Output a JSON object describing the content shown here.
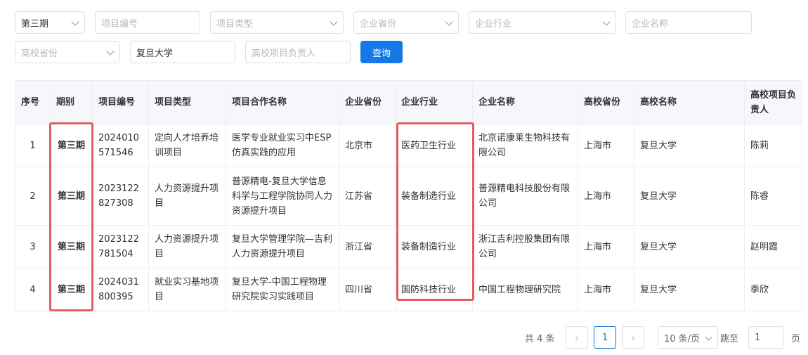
{
  "filters": {
    "period": {
      "value": "第三期"
    },
    "project_no": {
      "placeholder": "项目编号"
    },
    "project_type": {
      "placeholder": "项目类型"
    },
    "company_province": {
      "placeholder": "企业省份"
    },
    "company_industry": {
      "placeholder": "企业行业"
    },
    "company_name": {
      "placeholder": "企业名称"
    },
    "school_province": {
      "placeholder": "高校省份"
    },
    "school_name": {
      "value": "复旦大学"
    },
    "school_leader": {
      "placeholder": "高校项目负责人"
    },
    "search_label": "查询"
  },
  "table": {
    "headers": {
      "index": "序号",
      "period": "期别",
      "project_no": "项目编号",
      "project_type": "项目类型",
      "coop_name": "项目合作名称",
      "company_province": "企业省份",
      "company_industry": "企业行业",
      "company_name": "企业名称",
      "school_province": "高校省份",
      "school_name": "高校名称",
      "school_leader": "高校项目负责人"
    },
    "rows": [
      {
        "index": "1",
        "period": "第三期",
        "project_no": "2024010571546",
        "project_type": "定向人才培养培训项目",
        "coop_name": "医学专业就业实习中ESP仿真实践的应用",
        "company_province": "北京市",
        "company_industry": "医药卫生行业",
        "company_name": "北京诺康莱生物科技有限公司",
        "school_province": "上海市",
        "school_name": "复旦大学",
        "school_leader": "陈莉"
      },
      {
        "index": "2",
        "period": "第三期",
        "project_no": "2023122827308",
        "project_type": "人力资源提升项目",
        "coop_name": "普源精电-复旦大学信息科学与工程学院协同人力资源提升项目",
        "company_province": "江苏省",
        "company_industry": "装备制造行业",
        "company_name": "普源精电科技股份有限公司",
        "school_province": "上海市",
        "school_name": "复旦大学",
        "school_leader": "陈睿"
      },
      {
        "index": "3",
        "period": "第三期",
        "project_no": "2023122781504",
        "project_type": "人力资源提升项目",
        "coop_name": "复旦大学管理学院—吉利人力资源提升项目",
        "company_province": "浙江省",
        "company_industry": "装备制造行业",
        "company_name": "浙江吉利控股集团有限公司",
        "school_province": "上海市",
        "school_name": "复旦大学",
        "school_leader": "赵明霞"
      },
      {
        "index": "4",
        "period": "第三期",
        "project_no": "2024031800395",
        "project_type": "就业实习基地项目",
        "coop_name": "复旦大学-中国工程物理研究院实习实践项目",
        "company_province": "四川省",
        "company_industry": "国防科技行业",
        "company_name": "中国工程物理研究院",
        "school_province": "上海市",
        "school_name": "复旦大学",
        "school_leader": "季欣"
      }
    ]
  },
  "pagination": {
    "total_text": "共 4 条",
    "prev": "‹",
    "current_page": "1",
    "next": "›",
    "page_size": "10 条/页",
    "jump_label": "跳至",
    "jump_value": "1",
    "page_unit": "页"
  },
  "highlight_color": "#e35d5d",
  "accent_color": "#1677e6"
}
